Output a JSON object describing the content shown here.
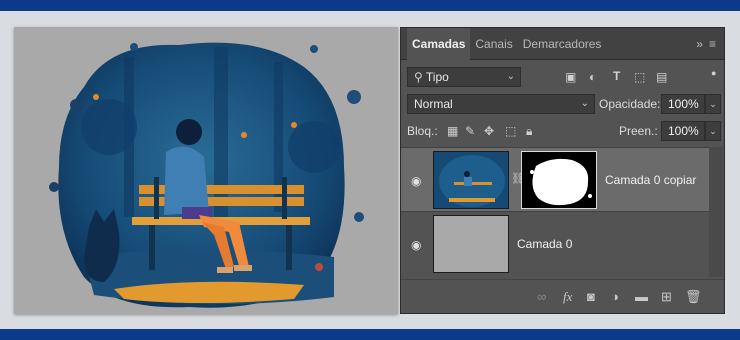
{
  "panel": {
    "tabs": [
      "Camadas",
      "Canais",
      "Demarcadores"
    ],
    "overflow_icon": "double-chevron-right-icon",
    "menu_icon": "panel-menu-icon"
  },
  "filter": {
    "kind_label": "Tipo",
    "icons": [
      "image-filter-icon",
      "adjustment-filter-icon",
      "type-filter-icon",
      "shape-filter-icon",
      "smart-object-filter-icon"
    ]
  },
  "blend": {
    "mode": "Normal",
    "opacity_label": "Opacidade:",
    "opacity_value": "100%"
  },
  "lock": {
    "label": "Bloq.:",
    "fill_label": "Preen.:",
    "fill_value": "100%"
  },
  "layers": [
    {
      "name": "Camada 0 copiar",
      "visible": true,
      "selected": true,
      "has_mask": true
    },
    {
      "name": "Camada 0",
      "visible": true,
      "selected": false,
      "has_mask": false
    }
  ],
  "footer_icons": [
    "link-layers-icon",
    "fx-icon",
    "add-mask-icon",
    "adjustment-layer-icon",
    "new-group-icon",
    "new-layer-icon",
    "trash-icon"
  ],
  "footer_fx": "fx",
  "colors": {
    "brand_band": "#0b3a8a",
    "panel_bg": "#535353",
    "selected_layer": "#6b6b6b"
  }
}
